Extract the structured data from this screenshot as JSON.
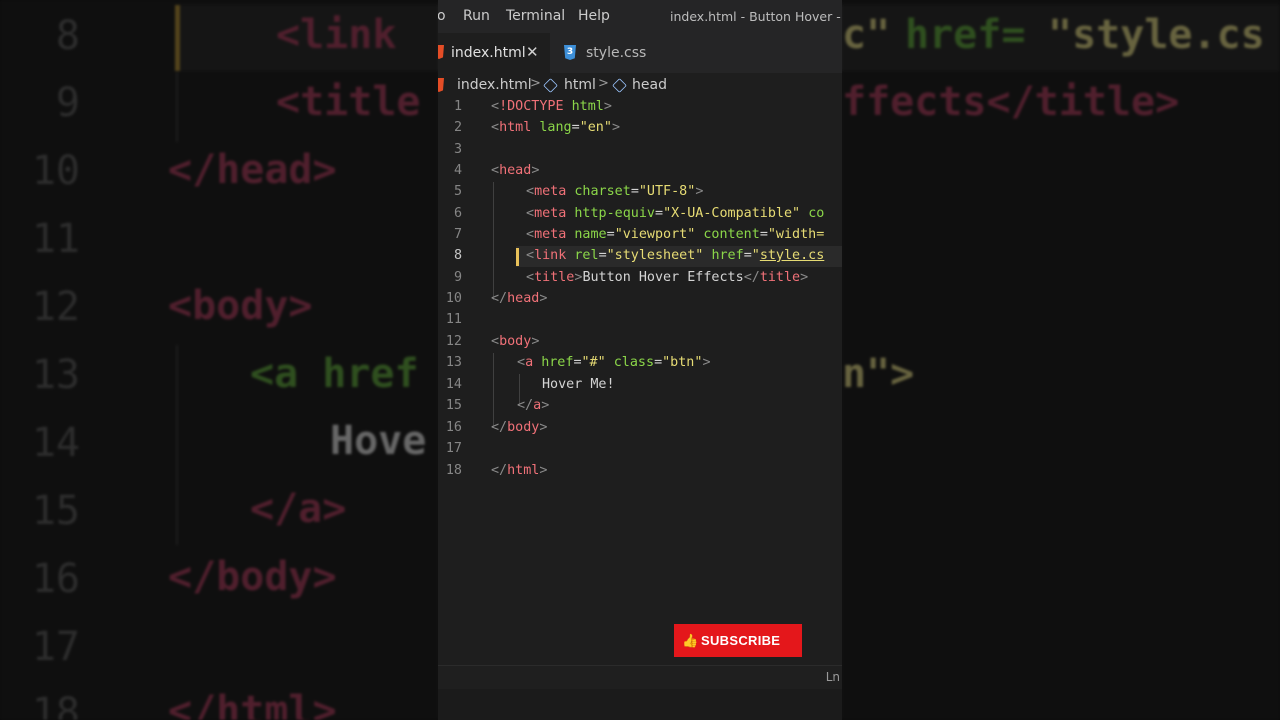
{
  "menubar": {
    "items": [
      "o",
      "Run",
      "Terminal",
      "Help"
    ],
    "window_title": "index.html - Button Hover - V"
  },
  "tabs": [
    {
      "label": "index.html",
      "icon": "html-icon",
      "active": true
    },
    {
      "label": "style.css",
      "icon": "css-icon",
      "active": false
    }
  ],
  "tab_close": "✕",
  "breadcrumb": [
    "index.html",
    "html",
    "head"
  ],
  "code_lines": [
    {
      "num": "1",
      "text": "<!DOCTYPE html>"
    },
    {
      "num": "2",
      "text": "<html lang=\"en\">"
    },
    {
      "num": "3",
      "text": ""
    },
    {
      "num": "4",
      "text": "<head>"
    },
    {
      "num": "5",
      "text": "<meta charset=\"UTF-8\">"
    },
    {
      "num": "6",
      "text": "<meta http-equiv=\"X-UA-Compatible\" co"
    },
    {
      "num": "7",
      "text": "<meta name=\"viewport\" content=\"width="
    },
    {
      "num": "8",
      "text": "<link rel=\"stylesheet\" href=\"style.cs"
    },
    {
      "num": "9",
      "text": "<title>Button Hover Effects</title>"
    },
    {
      "num": "10",
      "text": "</head>"
    },
    {
      "num": "11",
      "text": ""
    },
    {
      "num": "12",
      "text": "<body>"
    },
    {
      "num": "13",
      "text": "<a href=\"#\" class=\"btn\">"
    },
    {
      "num": "14",
      "text": "Hover Me!"
    },
    {
      "num": "15",
      "text": "</a>"
    },
    {
      "num": "16",
      "text": "</body>"
    },
    {
      "num": "17",
      "text": ""
    },
    {
      "num": "18",
      "text": "</html>"
    }
  ],
  "active_line": "8",
  "subscribe": {
    "label": "SUBSCRIBE",
    "icon": "thumbs-up-icon"
  },
  "statusbar": {
    "text": "Ln"
  },
  "background": {
    "line_numbers": [
      "8",
      "9",
      "10",
      "11",
      "12",
      "13",
      "14",
      "15",
      "16",
      "17",
      "18"
    ],
    "left_fragments": {
      "l8": "<link",
      "l9": "<title",
      "l10": "</head>",
      "l12": "<body>",
      "l13": "<a href",
      "l14": "Hove",
      "l15": "</a>",
      "l16": "</body>",
      "l18": "</html>"
    },
    "right_fragments": {
      "r8a": "c\"",
      "r8b": "href=",
      "r8c": "\"style.cs",
      "r9": "ffects</title>",
      "r13": "n\">"
    }
  },
  "colors": {
    "editor_bg": "#1e1e1e",
    "tag_name": "#f07178",
    "attribute": "#8bd649",
    "string": "#e6db74",
    "subscribe_bg": "#e4171b"
  }
}
